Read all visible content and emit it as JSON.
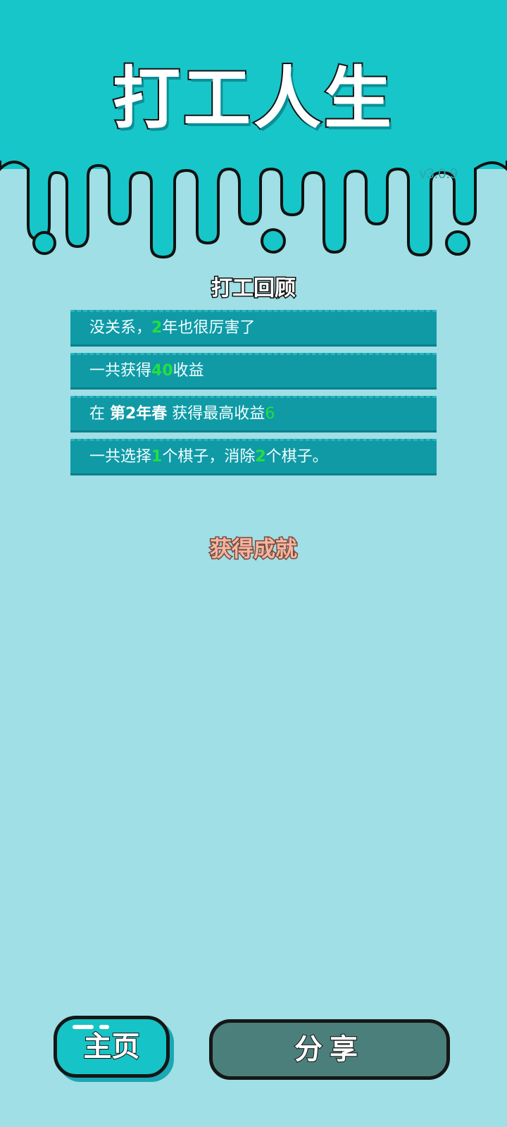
{
  "header": {
    "title": "打工人生",
    "version": "v3.0.9"
  },
  "review": {
    "title": "打工回顾",
    "items": [
      {
        "pre": "没关系，",
        "value": "2",
        "post": "年也很厉害了"
      },
      {
        "pre": "一共获得",
        "value": "40",
        "post": "收益"
      },
      {
        "pre": "在 ",
        "bold": "第2年春",
        "mid": " 获得最高收益",
        "value": "6"
      },
      {
        "pre": "一共选择",
        "value1": "1",
        "mid": "个棋子，消除",
        "value2": "2",
        "post": "个棋子。"
      }
    ]
  },
  "achievements": {
    "title": "获得成就"
  },
  "buttons": {
    "home_label": "主页",
    "share_label": "分享"
  },
  "colors": {
    "header_bg": "#17c6c9",
    "page_bg": "#9fdfe5",
    "item_bg": "#0f9aa6",
    "highlight": "#22e03e",
    "share_button": "#4b7f7c"
  }
}
